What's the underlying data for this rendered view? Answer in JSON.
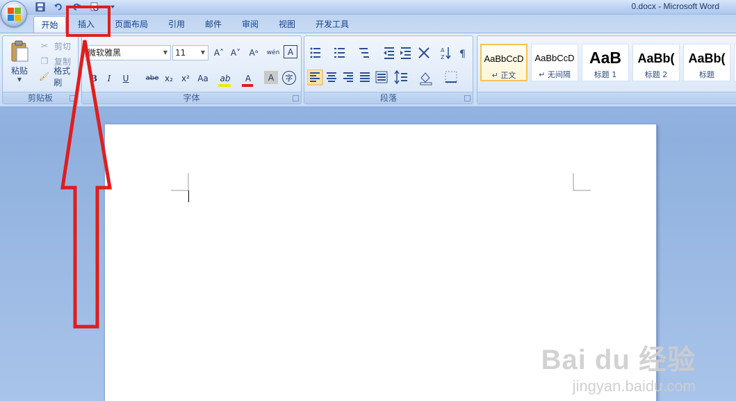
{
  "window": {
    "title": "0.docx - Microsoft Word"
  },
  "tabs": [
    {
      "label": "开始",
      "active": true
    },
    {
      "label": "插入"
    },
    {
      "label": "页面布局"
    },
    {
      "label": "引用"
    },
    {
      "label": "邮件"
    },
    {
      "label": "审阅"
    },
    {
      "label": "视图"
    },
    {
      "label": "开发工具"
    }
  ],
  "clipboard": {
    "label": "剪贴板",
    "paste": "粘贴",
    "cut": "剪切",
    "copy": "复制",
    "format_painter": "格式刷"
  },
  "font": {
    "label": "字体",
    "name": "微软雅黑",
    "size": "11",
    "icons": {
      "grow": "A˄",
      "shrink": "A˅",
      "clear": "Aᵃ",
      "phonetic": "wén",
      "border": "A",
      "bold": "B",
      "italic": "I",
      "underline": "U",
      "strike": "abe",
      "sub": "x₂",
      "sup": "x²",
      "case": "Aa",
      "highlight": "ab",
      "color": "A",
      "shade": "A",
      "enclose": "字"
    },
    "colors": {
      "highlight": "#f6e600",
      "font_color": "#e21b1b"
    }
  },
  "paragraph": {
    "label": "段落"
  },
  "styles": [
    {
      "sample": "AaBbCcD",
      "name": "↵ 正文",
      "selected": true
    },
    {
      "sample": "AaBbCcD",
      "name": "↵ 无间隔"
    },
    {
      "sample": "AaB",
      "name": "标题 1"
    },
    {
      "sample": "AaBb(",
      "name": "标题 2"
    },
    {
      "sample": "AaBb(",
      "name": "标题"
    }
  ],
  "watermark": {
    "logo": "Bai du 经验",
    "sub": "jingyan.baidu.com"
  },
  "annotation": {
    "highlight_color": "#e01d1d",
    "target": "插入"
  }
}
